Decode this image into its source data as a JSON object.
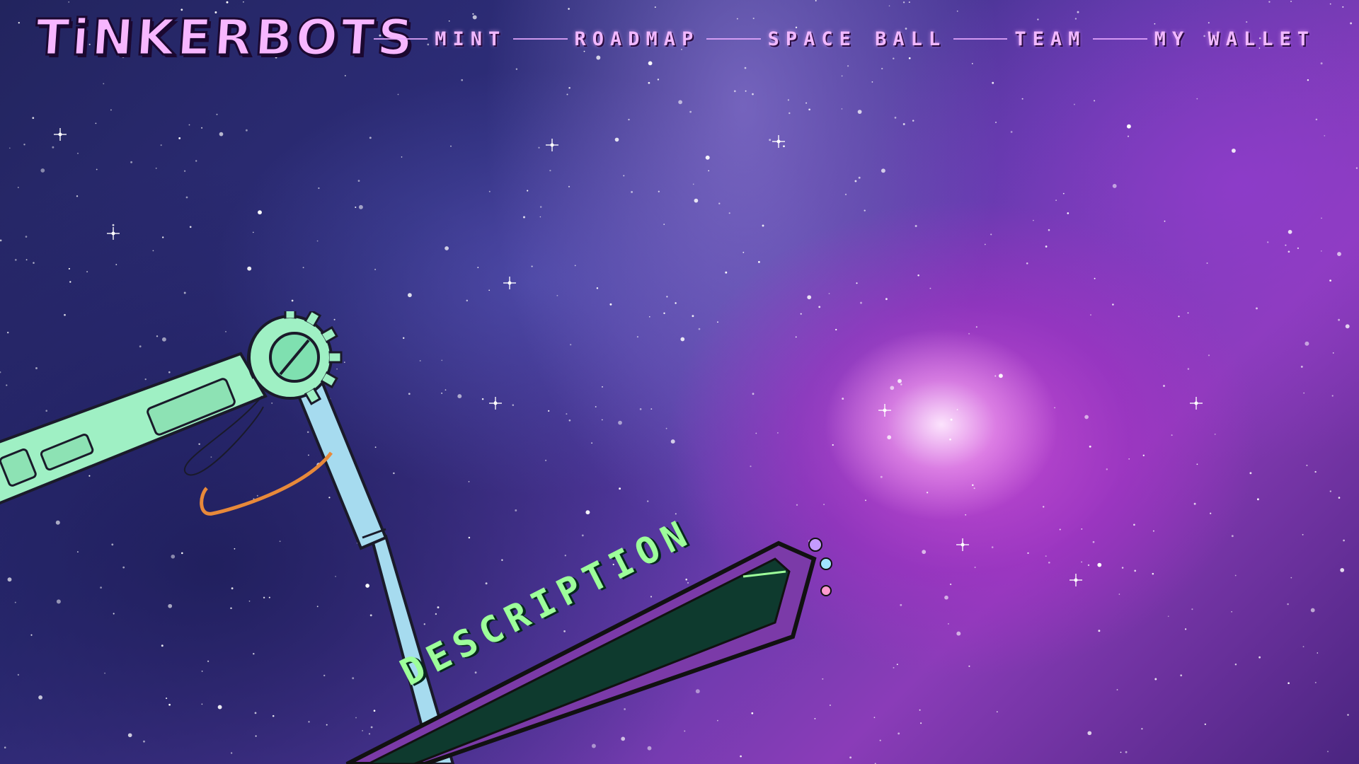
{
  "header": {
    "logo_text": "TiNKERBOTS",
    "nav": [
      {
        "label": "MINT"
      },
      {
        "label": "ROADMAP"
      },
      {
        "label": "SPACE BALL"
      },
      {
        "label": "TEAM"
      },
      {
        "label": "MY WALLET"
      }
    ]
  },
  "banner": {
    "label": "DESCRIPTION"
  },
  "colors": {
    "logo": "#f7b6ff",
    "nav": "#f1b8ff",
    "banner_text": "#9dff9a",
    "banner_fill": "#0e3a2e",
    "banner_border": "#7b3aa8",
    "arm": "#9ff0c4",
    "rod": "#a6dbef"
  }
}
